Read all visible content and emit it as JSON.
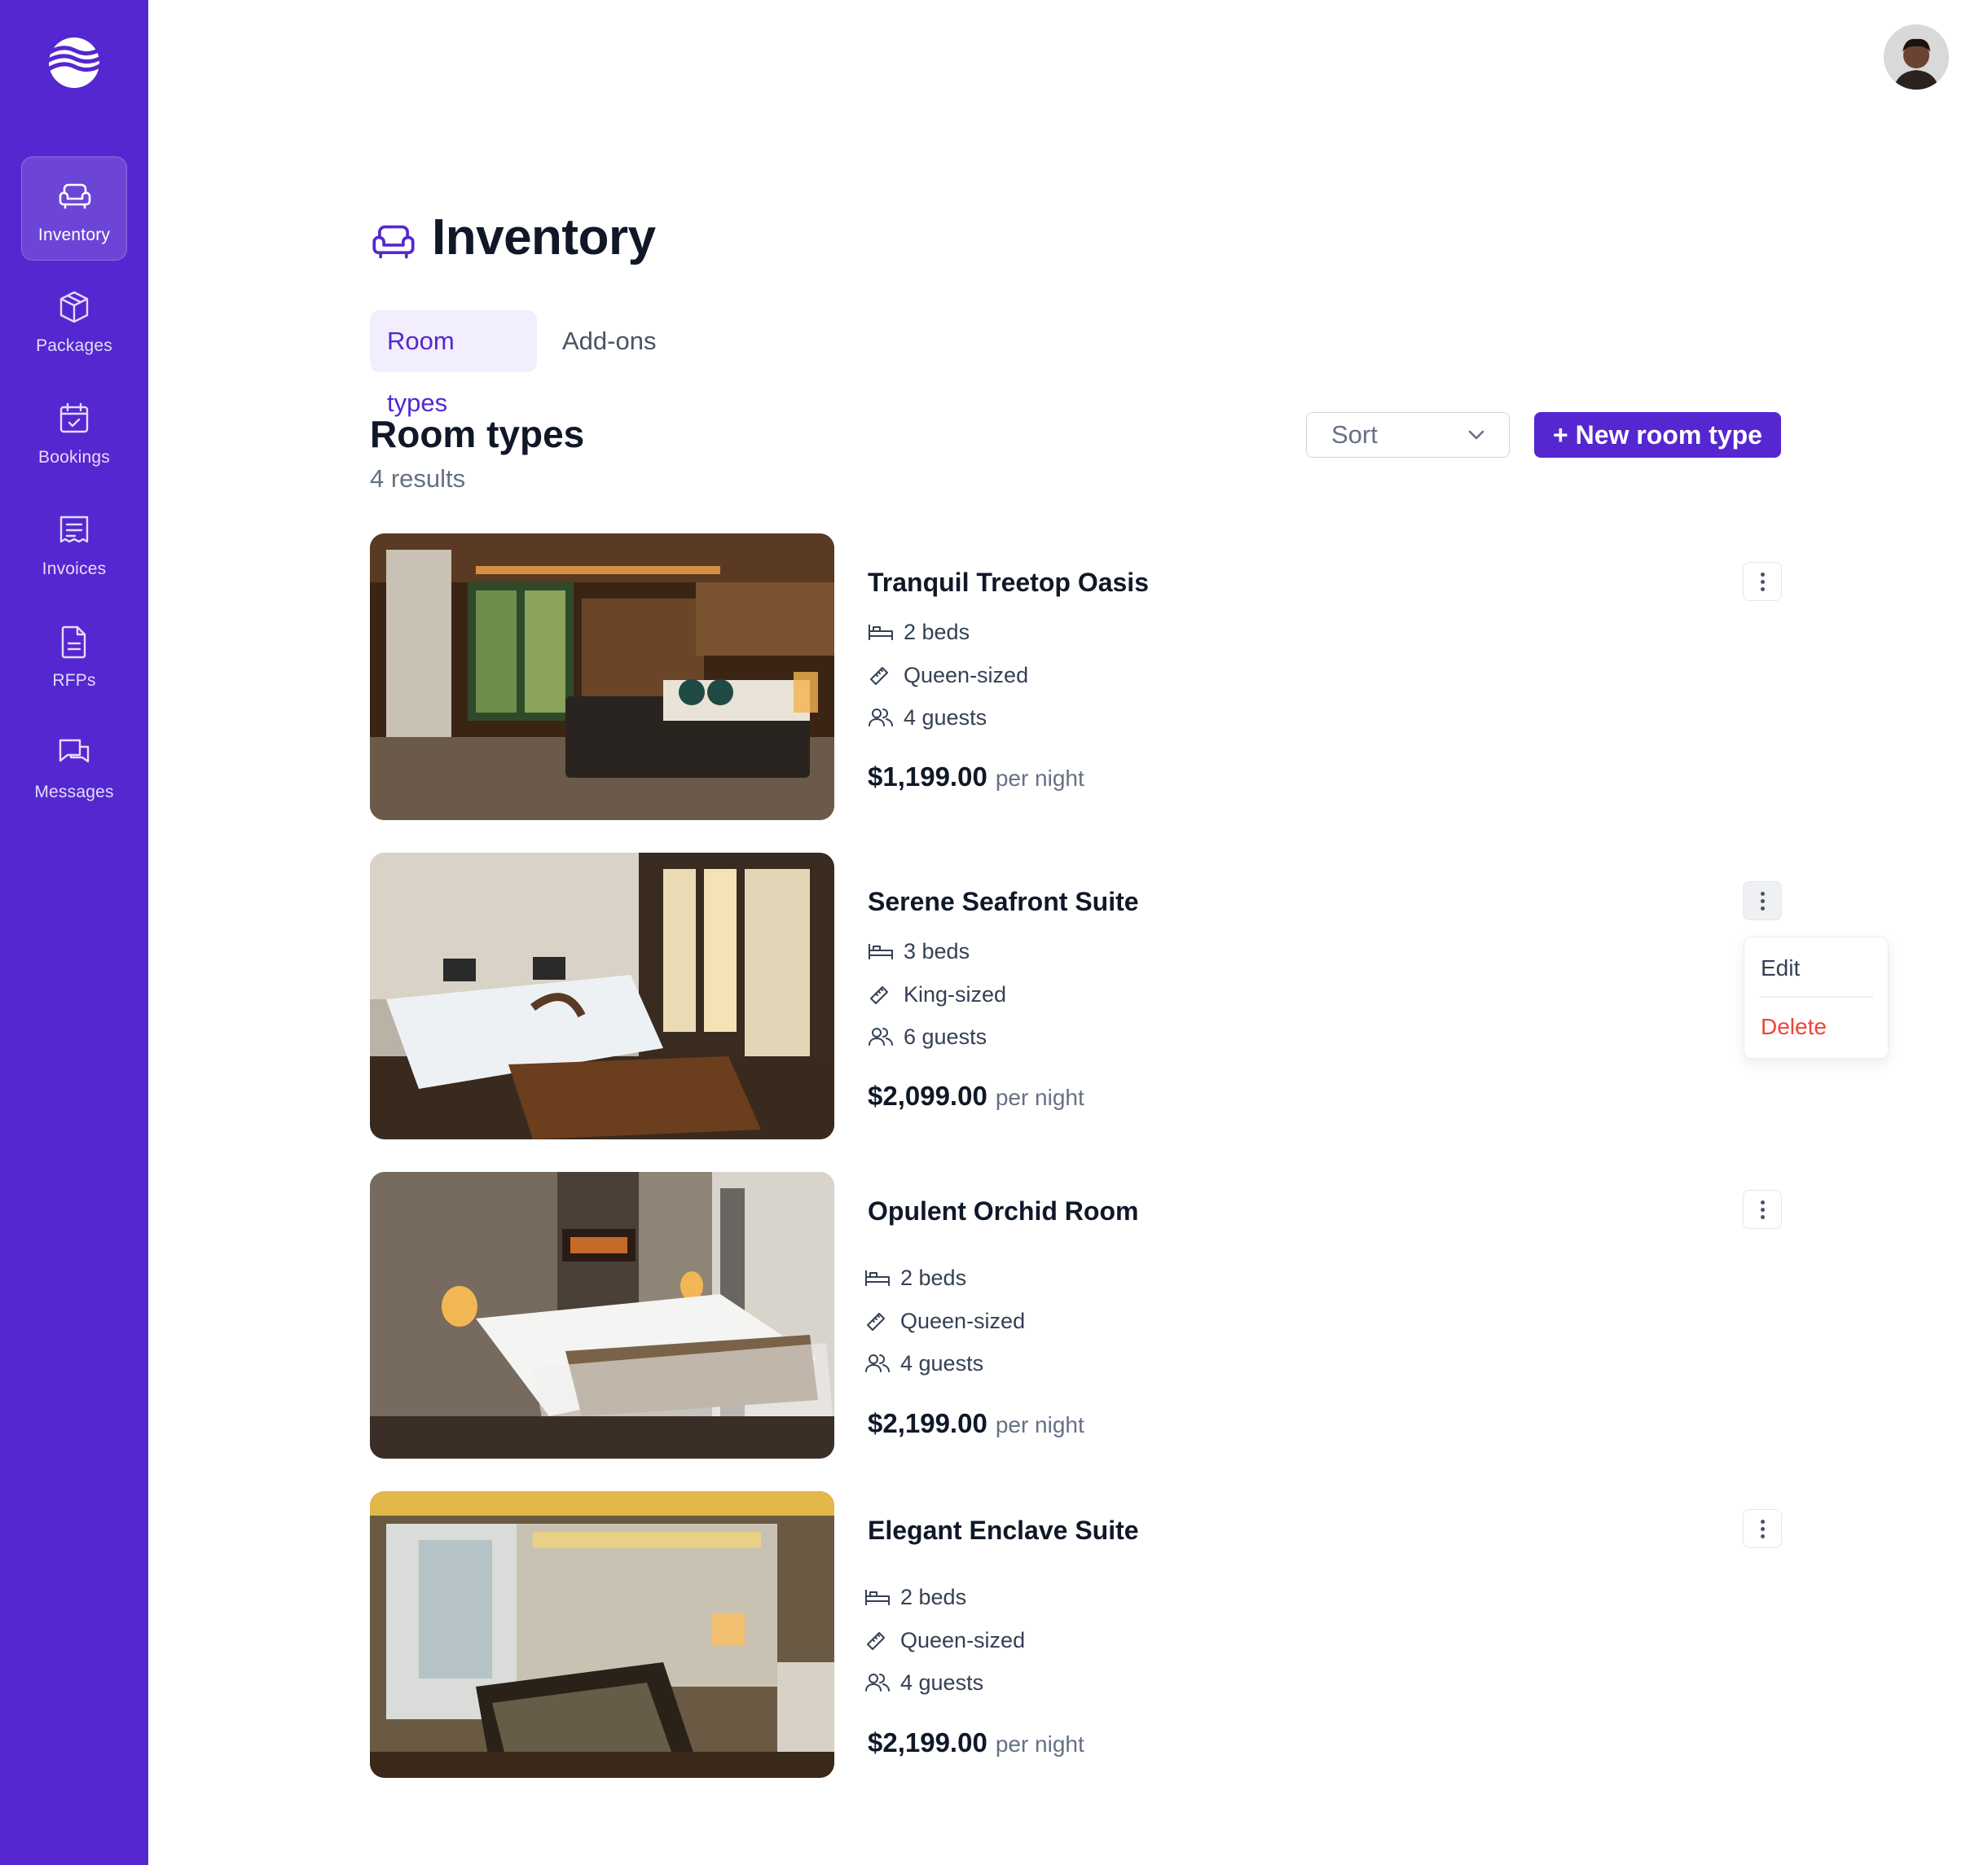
{
  "app": {
    "accent_color": "#5527D0",
    "sidebar": {
      "items": [
        {
          "label": "Inventory",
          "icon": "armchair-icon",
          "active": true
        },
        {
          "label": "Packages",
          "icon": "package-icon",
          "active": false
        },
        {
          "label": "Bookings",
          "icon": "calendar-check-icon",
          "active": false
        },
        {
          "label": "Invoices",
          "icon": "invoice-icon",
          "active": false
        },
        {
          "label": "RFPs",
          "icon": "document-icon",
          "active": false
        },
        {
          "label": "Messages",
          "icon": "messages-icon",
          "active": false
        }
      ]
    }
  },
  "page": {
    "title": "Inventory",
    "tabs": [
      {
        "label": "Room types",
        "active": true
      },
      {
        "label": "Add-ons",
        "active": false
      }
    ]
  },
  "section": {
    "title": "Room types",
    "count": "4 results",
    "sort_label": "Sort",
    "new_button": "+ New room type"
  },
  "rooms": [
    {
      "name": "Tranquil Treetop Oasis",
      "beds": "2 beds",
      "bed_size": "Queen-sized",
      "guests": "4 guests",
      "price": "$1,199.00",
      "per": "per night"
    },
    {
      "name": "Serene Seafront Suite",
      "beds": "3 beds",
      "bed_size": "King-sized",
      "guests": "6 guests",
      "price": "$2,099.00",
      "per": "per night"
    },
    {
      "name": "Opulent Orchid Room",
      "beds": "2 beds",
      "bed_size": "Queen-sized",
      "guests": "4 guests",
      "price": "$2,199.00",
      "per": "per night"
    },
    {
      "name": "Elegant Enclave Suite",
      "beds": "2 beds",
      "bed_size": "Queen-sized",
      "guests": "4 guests",
      "price": "$2,199.00",
      "per": "per night"
    }
  ],
  "menu": {
    "edit": "Edit",
    "delete": "Delete",
    "delete_color": "#F04438"
  }
}
